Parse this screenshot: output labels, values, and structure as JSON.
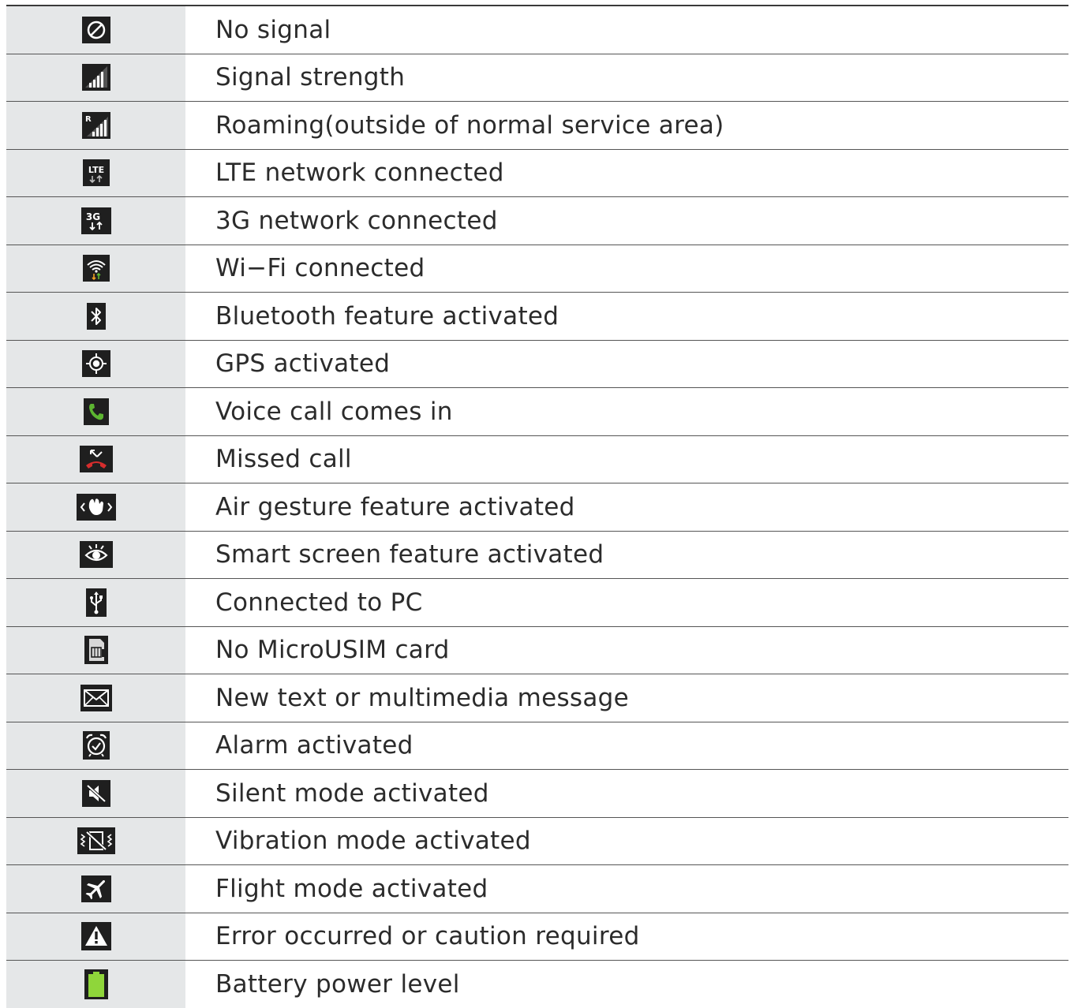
{
  "rows": [
    {
      "icon": "no-signal-icon",
      "label": "No signal"
    },
    {
      "icon": "signal-strength-icon",
      "label": "Signal strength"
    },
    {
      "icon": "roaming-icon",
      "label": "Roaming(outside of normal service area)"
    },
    {
      "icon": "lte-icon",
      "label": "LTE network connected"
    },
    {
      "icon": "3g-icon",
      "label": "3G network connected"
    },
    {
      "icon": "wifi-icon",
      "label": "Wi−Fi connected"
    },
    {
      "icon": "bluetooth-icon",
      "label": "Bluetooth feature activated"
    },
    {
      "icon": "gps-icon",
      "label": "GPS activated"
    },
    {
      "icon": "voice-call-icon",
      "label": "Voice call comes in"
    },
    {
      "icon": "missed-call-icon",
      "label": "Missed call"
    },
    {
      "icon": "air-gesture-icon",
      "label": "Air gesture feature activated"
    },
    {
      "icon": "smart-screen-icon",
      "label": "Smart screen feature activated"
    },
    {
      "icon": "usb-icon",
      "label": "Connected to PC"
    },
    {
      "icon": "no-sim-icon",
      "label": "No MicroUSIM card"
    },
    {
      "icon": "message-icon",
      "label": "New text or multimedia message"
    },
    {
      "icon": "alarm-icon",
      "label": "Alarm activated"
    },
    {
      "icon": "silent-mode-icon",
      "label": "Silent mode activated"
    },
    {
      "icon": "vibration-mode-icon",
      "label": "Vibration mode activated"
    },
    {
      "icon": "flight-mode-icon",
      "label": "Flight mode activated"
    },
    {
      "icon": "warning-icon",
      "label": "Error occurred or caution required"
    },
    {
      "icon": "battery-icon",
      "label": "Battery power level"
    }
  ],
  "colors": {
    "icon_bg": "#1f1f1f",
    "call_green": "#5cb531",
    "missed_red": "#d62d2d",
    "battery_green": "#8fd63a",
    "wifi_orange": "#f0a020"
  }
}
